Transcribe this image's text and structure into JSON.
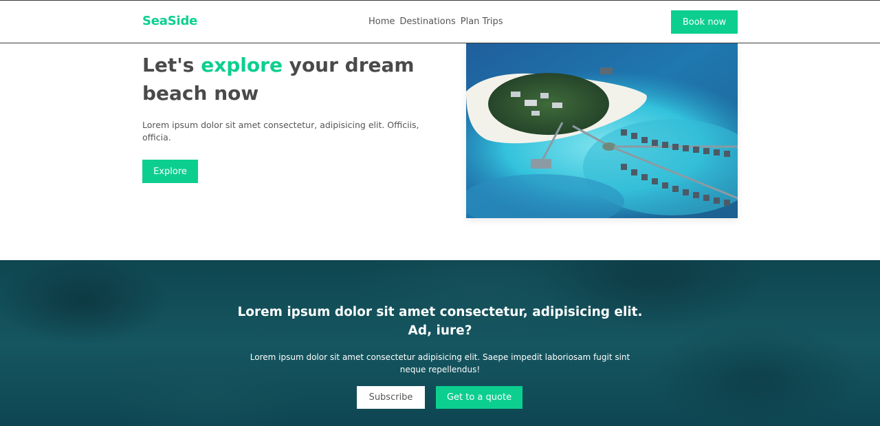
{
  "nav": {
    "brand": "SeaSide",
    "links": [
      "Home",
      "Destinations",
      "Plan Trips"
    ],
    "book_label": "Book now"
  },
  "hero": {
    "title_before": "Let's ",
    "title_accent": "explore",
    "title_after": " your dream beach now",
    "text": "Lorem ipsum dolor sit amet consectetur, adipisicing elit. Officiis, officia.",
    "explore_label": "Explore"
  },
  "cta": {
    "title": "Lorem ipsum dolor sit amet consectetur, adipisicing elit. Ad, iure?",
    "text": "Lorem ipsum dolor sit amet consectetur adipisicing elit. Saepe impedit laboriosam fugit sint neque repellendus!",
    "subscribe_label": "Subscribe",
    "quote_label": "Get to a quote"
  },
  "colors": {
    "accent": "#0ccf8f",
    "heading": "#4a4a4a",
    "cta_background": "#124e58"
  }
}
